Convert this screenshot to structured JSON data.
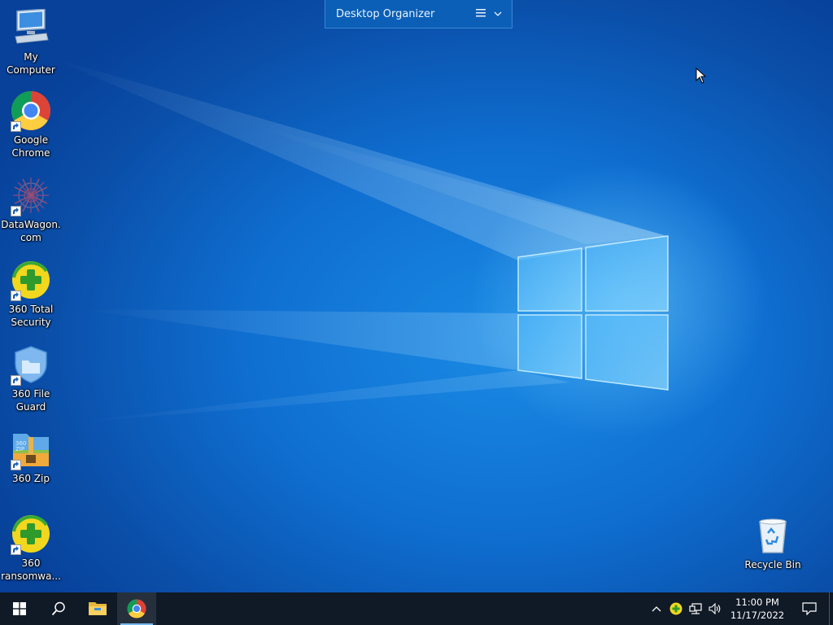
{
  "desktop": {
    "icons": [
      {
        "label": "My Computer",
        "icon": "computer-icon"
      },
      {
        "label": "Google Chrome",
        "icon": "chrome-icon",
        "shortcut": true
      },
      {
        "label": "DataWagon.com",
        "icon": "datawagon-icon",
        "shortcut": true
      },
      {
        "label": "360 Total Security",
        "icon": "360-total-security-icon",
        "shortcut": true
      },
      {
        "label": "360 File Guard",
        "icon": "360-file-guard-icon",
        "shortcut": true
      },
      {
        "label": "360 Zip",
        "icon": "360-zip-icon",
        "shortcut": true
      },
      {
        "label": "360 ransomwa...",
        "icon": "360-ransomware-icon",
        "shortcut": true
      }
    ],
    "recycle_bin": {
      "label": "Recycle Bin",
      "icon": "recycle-bin-icon"
    }
  },
  "organizer": {
    "title": "Desktop Organizer",
    "menu_icon": "menu-icon",
    "expand_icon": "chevron-down-icon"
  },
  "taskbar": {
    "start_icon": "windows-start-icon",
    "search_icon": "search-icon",
    "pinned": [
      {
        "name": "File Explorer",
        "icon": "folder-icon",
        "active": false
      },
      {
        "name": "Google Chrome",
        "icon": "chrome-icon",
        "active": true
      }
    ],
    "tray": {
      "icons": [
        "chevron-up-icon",
        "360-tray-icon",
        "network-icon",
        "volume-icon"
      ],
      "time": "11:00 PM",
      "date": "11/17/2022",
      "notification_icon": "notification-icon"
    }
  },
  "colors": {
    "wallpaper": "#0f6fd1",
    "taskbar": "#101926",
    "accent": "#76b9ed"
  }
}
